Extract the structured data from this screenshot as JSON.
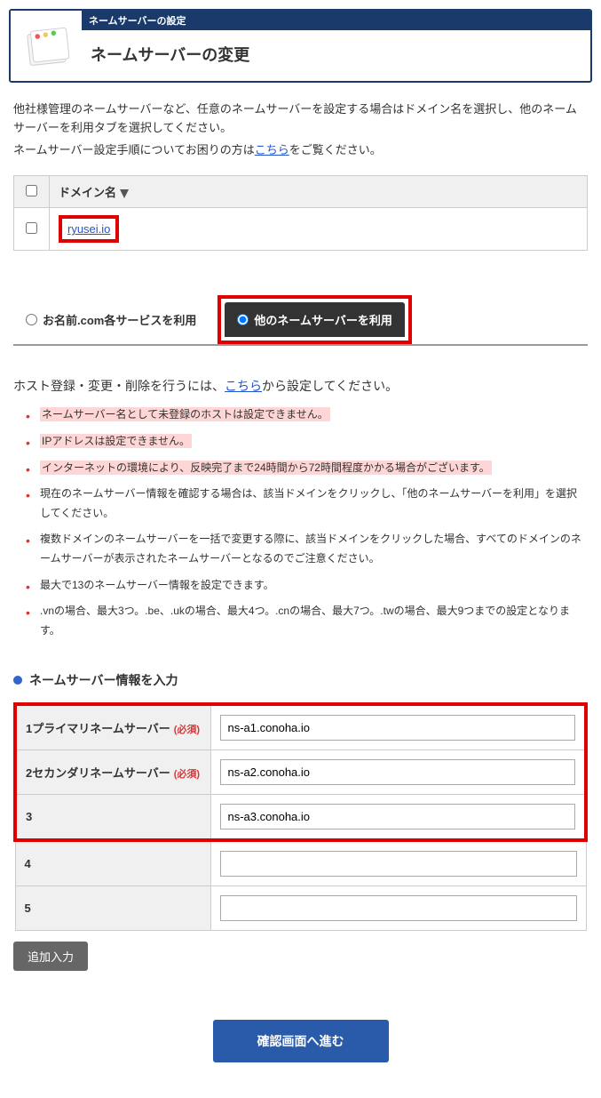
{
  "header": {
    "breadcrumb": "ネームサーバーの設定",
    "title": "ネームサーバーの変更"
  },
  "intro": {
    "line1a": "他社様管理のネームサーバーなど、任意のネームサーバーを設定する場合はドメイン名を選択し、他のネームサーバーを利用タブを選択してください。",
    "line2a": "ネームサーバー設定手順についてお困りの方は",
    "link": "こちら",
    "line2b": "をご覧ください。"
  },
  "domain_table": {
    "col_domain": "ドメイン名",
    "rows": [
      {
        "name": "ryusei.io"
      }
    ]
  },
  "tabs": {
    "inactive": "お名前.com各サービスを利用",
    "active": "他のネームサーバーを利用"
  },
  "host_text": {
    "pre": "ホスト登録・変更・削除を行うには、",
    "link": "こちら",
    "post": "から設定してください。"
  },
  "warnings": [
    "ネームサーバー名として未登録のホストは設定できません。",
    "IPアドレスは設定できません。",
    "インターネットの環境により、反映完了まで24時間から72時間程度かかる場合がございます。",
    "現在のネームサーバー情報を確認する場合は、該当ドメインをクリックし、「他のネームサーバーを利用」を選択してください。",
    "複数ドメインのネームサーバーを一括で変更する際に、該当ドメインをクリックした場合、すべてのドメインのネームサーバーが表示されたネームサーバーとなるのでご注意ください。",
    "最大で13のネームサーバー情報を設定できます。",
    ".vnの場合、最大3つ。.be、.ukの場合、最大4つ。.cnの場合、最大7つ。.twの場合、最大9つまでの設定となります。"
  ],
  "warn_highlight_indices": [
    0,
    1,
    2
  ],
  "ns_section": {
    "heading": "ネームサーバー情報を入力",
    "required_label": "(必須)",
    "rows": [
      {
        "label": "1プライマリネームサーバー",
        "required": true,
        "value": "ns-a1.conoha.io",
        "highlight": true
      },
      {
        "label": "2セカンダリネームサーバー",
        "required": true,
        "value": "ns-a2.conoha.io",
        "highlight": true
      },
      {
        "label": "3",
        "required": false,
        "value": "ns-a3.conoha.io",
        "highlight": true
      },
      {
        "label": "4",
        "required": false,
        "value": "",
        "highlight": false
      },
      {
        "label": "5",
        "required": false,
        "value": "",
        "highlight": false
      }
    ]
  },
  "buttons": {
    "add": "追加入力",
    "confirm": "確認画面へ進む"
  }
}
